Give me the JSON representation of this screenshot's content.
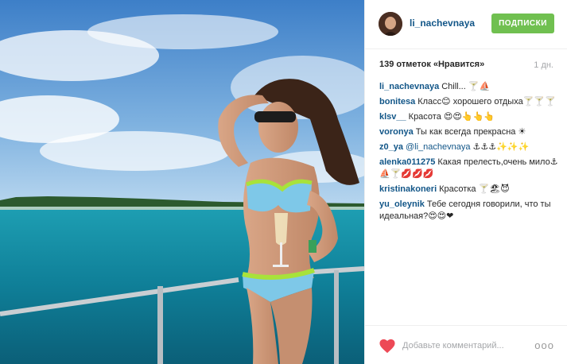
{
  "header": {
    "username": "li_nachevnaya",
    "follow_label": "ПОДПИСКИ"
  },
  "stats": {
    "likes_text": "139 отметок «Нравится»",
    "age": "1 дн."
  },
  "comments": [
    {
      "user": "li_nachevnaya",
      "text": "Chill... 🍸⛵"
    },
    {
      "user": "bonitesa",
      "text": "Класс😊 хорошего отдыха🍸🍸🍸"
    },
    {
      "user": "klsv__",
      "text": "Красота 😍😍👆👆👆"
    },
    {
      "user": "voronya",
      "text": "Ты как всегда прекрасна ☀"
    },
    {
      "user": "z0_ya",
      "mention": "@li_nachevnaya",
      "text": " ⚓⚓⚓✨✨✨"
    },
    {
      "user": "alenka011275",
      "text": "Какая прелесть,очень мило⚓⛵🍸💋💋💋"
    },
    {
      "user": "kristinakoneri",
      "text": "Красотка 🍸🏖😈"
    },
    {
      "user": "yu_oleynik",
      "text": "Тебе сегодня говорили, что ты идеальная?😍😍❤"
    }
  ],
  "footer": {
    "comment_placeholder": "Добавьте комментарий...",
    "more_label": "ooo",
    "like_icon": "heart-icon",
    "like_color": "#ed4956"
  },
  "colors": {
    "username": "#125688",
    "follow_bg": "#70c050"
  }
}
